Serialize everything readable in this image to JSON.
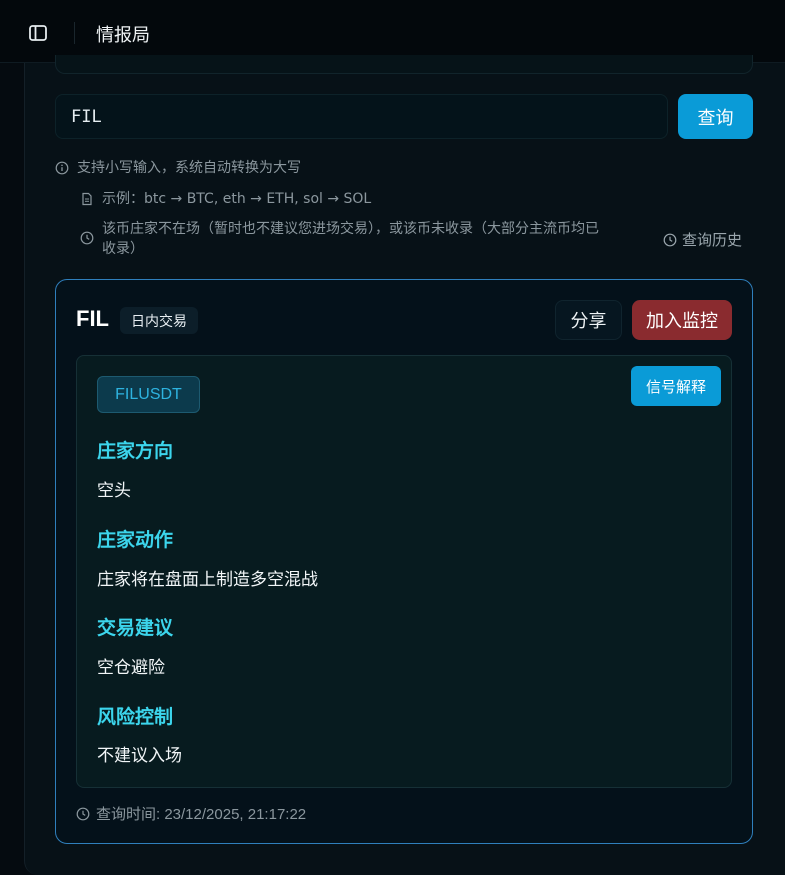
{
  "header": {
    "title": "情报局",
    "sidebar_toggle_icon": "sidebar-panel-icon"
  },
  "search": {
    "value": "FIL",
    "button_label": "查询"
  },
  "hints": {
    "tip": "支持小写输入，系统自动转换为大写",
    "example": "示例：btc → BTC, eth → ETH, sol → SOL",
    "notice_line1": "该币庄家不在场（暂时也不建议您进场交易），或该币未收录（大部分主流币均已",
    "notice_line2": "收录）",
    "history_label": "查询历史"
  },
  "result": {
    "symbol": "FIL",
    "mode_badge": "日内交易",
    "share_label": "分享",
    "monitor_label": "加入监控",
    "pair": "FILUSDT",
    "explain_label": "信号解释",
    "sections": [
      {
        "heading": "庄家方向",
        "value": "空头"
      },
      {
        "heading": "庄家动作",
        "value": "庄家将在盘面上制造多空混战"
      },
      {
        "heading": "交易建议",
        "value": "空仓避险"
      },
      {
        "heading": "风险控制",
        "value": "不建议入场"
      }
    ],
    "query_time": "查询时间: 23/12/2025, 21:17:22"
  },
  "colors": {
    "accent": "#0a9bd7",
    "danger": "#8a2b2f",
    "heading": "#3cd5ec",
    "card_border": "#2f7fbc"
  }
}
